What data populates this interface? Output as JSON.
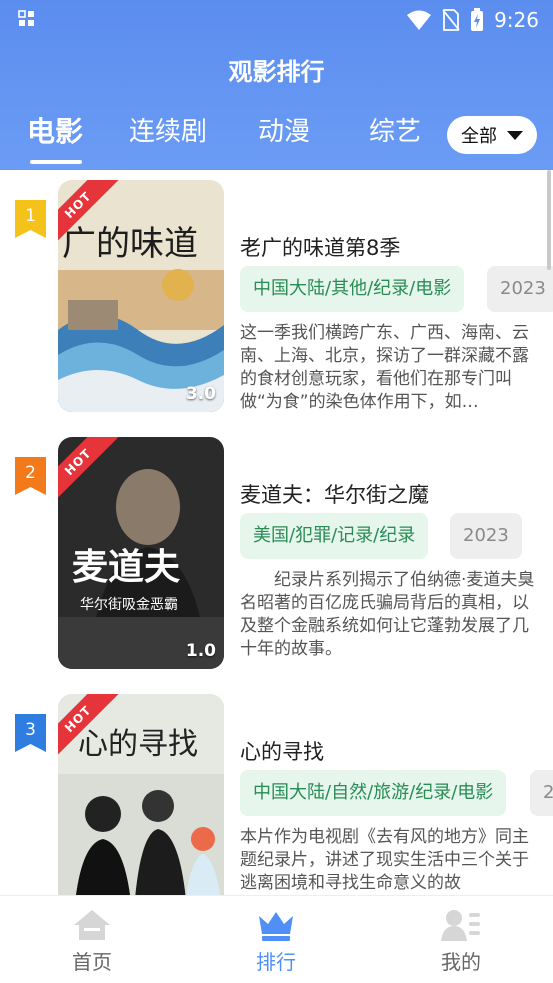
{
  "status_bar": {
    "time": "9:26"
  },
  "header": {
    "title": "观影排行",
    "tabs": [
      {
        "label": "电影",
        "active": true
      },
      {
        "label": "连续剧",
        "active": false
      },
      {
        "label": "动漫",
        "active": false
      },
      {
        "label": "综艺",
        "active": false
      }
    ],
    "filter": {
      "label": "全部"
    }
  },
  "items": [
    {
      "rank": "1",
      "badge_color": "#f5c21b",
      "title": "老广的味道第8季",
      "hot_label": "HOT",
      "score": "3.0",
      "poster_text": "广的味道",
      "genre": "中国大陆/其他/纪录/电影",
      "year": "2023",
      "description": "这一季我们横跨广东、广西、海南、云南、上海、北京，探访了一群深藏不露的食材创意玩家，看他们在那专门叫做“为食”的染色体作用下，如…"
    },
    {
      "rank": "2",
      "badge_color": "#f27a1a",
      "title": "麦道夫：华尔街之魔",
      "hot_label": "HOT",
      "score": "1.0",
      "poster_text": "麦道夫",
      "poster_subtext": "华尔街吸金恶霸",
      "genre": "美国/犯罪/记录/纪录",
      "year": "2023",
      "description": "　　纪录片系列揭示了伯纳德·麦道夫臭名昭著的百亿庞氏骗局背后的真相，以及整个金融系统如何让它蓬勃发展了几十年的故事。"
    },
    {
      "rank": "3",
      "badge_color": "#2f7de1",
      "title": "心的寻找",
      "hot_label": "HOT",
      "score": "",
      "poster_text": "心的寻找",
      "genre": "中国大陆/自然/旅游/纪录/电影",
      "year": "2",
      "description": "本片作为电视剧《去有风的地方》同主题纪录片，讲述了现实生活中三个关于逃离困境和寻找生命意义的故"
    }
  ],
  "bottom_nav": [
    {
      "label": "首页",
      "icon": "home-icon",
      "active": false
    },
    {
      "label": "排行",
      "icon": "crown-icon",
      "active": true
    },
    {
      "label": "我的",
      "icon": "profile-icon",
      "active": false
    }
  ],
  "colors": {
    "accent": "#4f8ff7",
    "header": "#5b8def",
    "genre_text": "#2a8c55"
  }
}
